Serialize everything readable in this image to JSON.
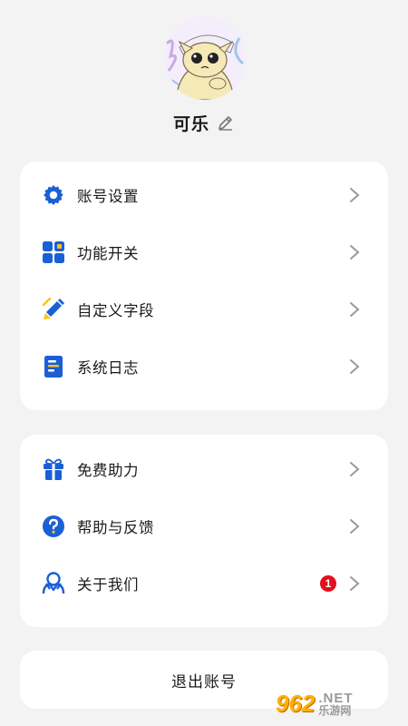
{
  "profile": {
    "username": "可乐"
  },
  "colors": {
    "accent": "#1a5fd6",
    "badge": "#e0111c",
    "background": "#f3f3f3",
    "card": "#ffffff"
  },
  "group1": {
    "items": [
      {
        "label": "账号设置",
        "icon": "gear-icon"
      },
      {
        "label": "功能开关",
        "icon": "grid-toggle-icon"
      },
      {
        "label": "自定义字段",
        "icon": "pencil-edit-icon"
      },
      {
        "label": "系统日志",
        "icon": "document-log-icon"
      }
    ]
  },
  "group2": {
    "items": [
      {
        "label": "免费助力",
        "icon": "gift-icon"
      },
      {
        "label": "帮助与反馈",
        "icon": "question-icon"
      },
      {
        "label": "关于我们",
        "icon": "people-icon",
        "badge": "1"
      }
    ]
  },
  "logout": {
    "label": "退出账号"
  },
  "watermark": {
    "number": "962",
    "net": ".NET",
    "site": "乐游网"
  }
}
